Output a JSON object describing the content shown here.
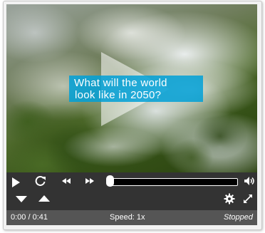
{
  "video": {
    "caption_line1": "What will the world",
    "caption_line2": "look like in 2050?"
  },
  "controls": {
    "play_icon": "play-icon",
    "replay_icon": "replay-icon",
    "rewind_icon": "rewind-icon",
    "forward_icon": "fast-forward-icon",
    "volume_icon": "volume-icon",
    "captions_down_icon": "caption-down-icon",
    "captions_up_icon": "caption-up-icon",
    "settings_icon": "gear-icon",
    "fullscreen_icon": "fullscreen-icon",
    "seek_progress": 0.0
  },
  "status": {
    "time": "0:00 / 0:41",
    "speed": "Speed: 1x",
    "state": "Stopped"
  },
  "colors": {
    "caption_bg": "#00a0d7",
    "controls_bg": "#333333",
    "status_bg": "#555555"
  }
}
